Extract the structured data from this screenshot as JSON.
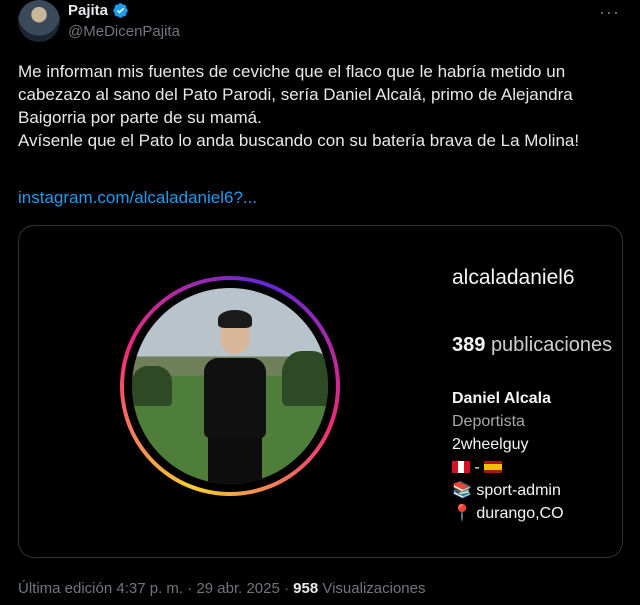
{
  "author": {
    "name": "Pajita",
    "handle": "@MeDicenPajita"
  },
  "tweet": {
    "text": "Me informan mis fuentes de ceviche que el flaco que le habría metido un cabezazo al sano del Pato Parodi, sería Daniel Alcalá, primo de Alejandra Baigorria por parte de su mamá.\nAvísenle que el Pato lo anda buscando con su batería brava de La Molina!",
    "link": "instagram.com/alcaladaniel6?..."
  },
  "media": {
    "username": "alcaladaniel6",
    "posts_count": "389",
    "posts_label": "publicaciones",
    "full_name": "Daniel Alcala",
    "category": "Deportista",
    "bio_line1": "2wheelguy",
    "bio_flags_sep": "-",
    "bio_line3": "sport-admin",
    "bio_line4": "durango,CO"
  },
  "footer": {
    "edited": "Última edición 4:37 p. m. · 29 abr. 2025 ·",
    "views_count": "958",
    "views_label": "Visualizaciones"
  },
  "colors": {
    "link": "#1d9bf0",
    "verified": "#1d9bf0",
    "muted": "#71767b"
  },
  "icons": [
    "verified-badge-icon",
    "more-options-icon",
    "peru-flag-icon",
    "spain-flag-icon",
    "books-icon",
    "pin-icon"
  ]
}
